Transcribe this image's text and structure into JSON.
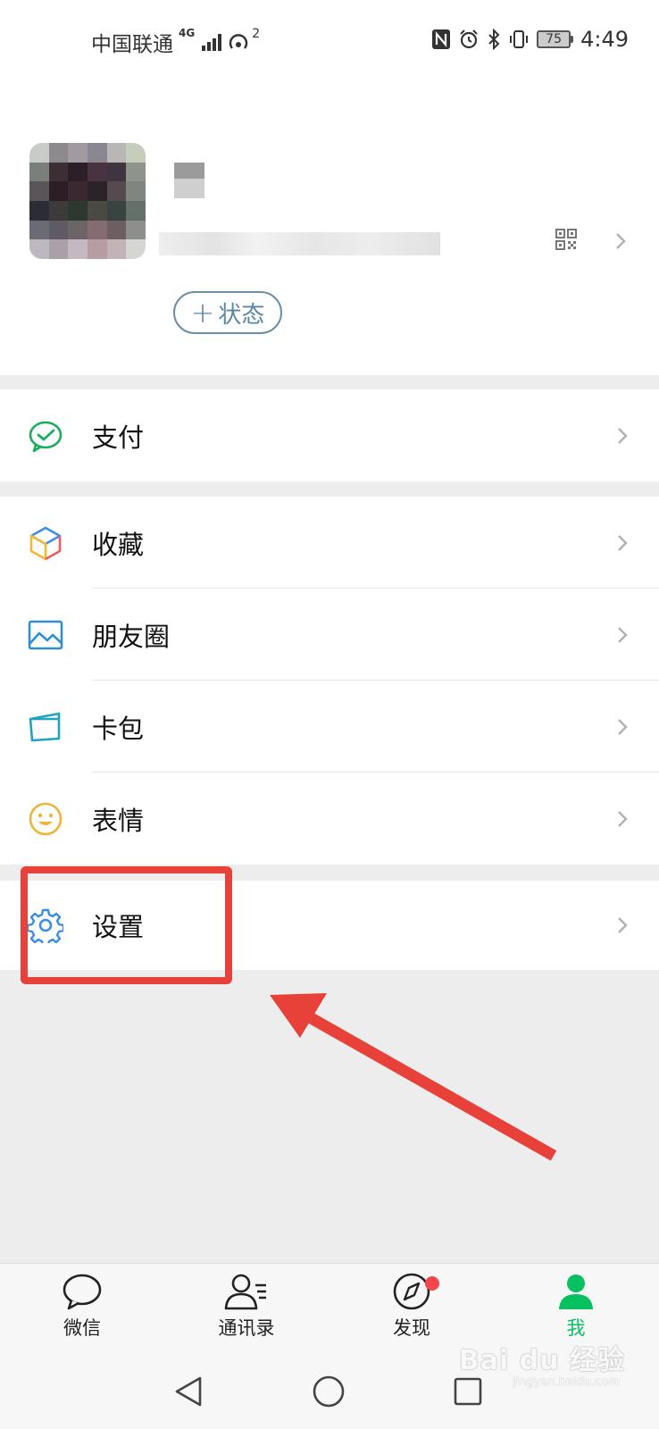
{
  "status_bar": {
    "carrier": "中国联通",
    "network": "4G",
    "hotspot_count": "2",
    "battery": "75",
    "time": "4:49"
  },
  "profile": {
    "status_button": "状态"
  },
  "menu": {
    "pay": "支付",
    "favorites": "收藏",
    "moments": "朋友圈",
    "cards": "卡包",
    "stickers": "表情",
    "settings": "设置"
  },
  "tabs": [
    {
      "label": "微信"
    },
    {
      "label": "通讯录"
    },
    {
      "label": "发现"
    },
    {
      "label": "我"
    }
  ],
  "watermark": {
    "text": "Bai du 经验",
    "sub": "jingyan.baidu.com"
  },
  "colors": {
    "accent_green": "#07c160",
    "highlight_red": "#e8413a",
    "pill_blue": "#5b87a6"
  },
  "icons": [
    "wechat-pay-icon",
    "favorites-cube-icon",
    "moments-image-icon",
    "card-wallet-icon",
    "smiley-icon",
    "gear-icon",
    "qr-code-icon",
    "chevron-right-icon",
    "chat-bubble-icon",
    "contacts-icon",
    "compass-icon",
    "person-icon"
  ]
}
